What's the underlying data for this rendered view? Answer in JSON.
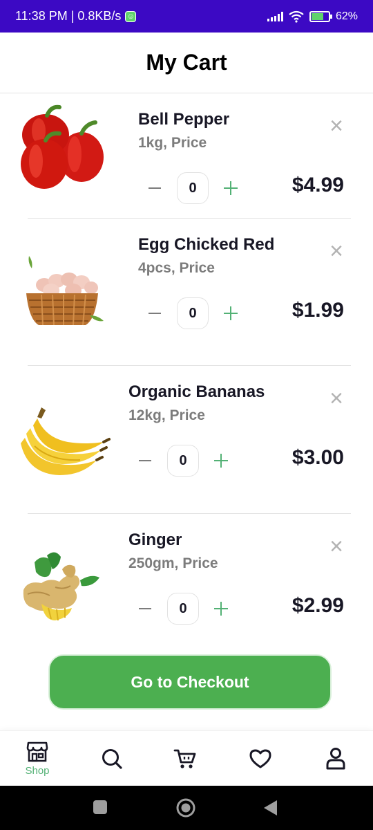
{
  "status_bar": {
    "time": "11:38 PM | 0.8KB/s",
    "battery": "62%",
    "colors": {
      "background": "#3c09c4"
    }
  },
  "header": {
    "title": "My Cart"
  },
  "cart": {
    "items": [
      {
        "name": "Bell Pepper",
        "subtitle": "1kg, Price",
        "quantity": "0",
        "price": "$4.99",
        "image": "bell-pepper-image"
      },
      {
        "name": "Egg Chicked Red",
        "subtitle": "4pcs, Price",
        "quantity": "0",
        "price": "$1.99",
        "image": "egg-basket-image"
      },
      {
        "name": "Organic Bananas",
        "subtitle": "12kg, Price",
        "quantity": "0",
        "price": "$3.00",
        "image": "bananas-image"
      },
      {
        "name": "Ginger",
        "subtitle": "250gm, Price",
        "quantity": "0",
        "price": "$2.99",
        "image": "ginger-image"
      }
    ]
  },
  "checkout": {
    "label": "Go to Checkout",
    "color": "#4caf50"
  },
  "bottom_nav": {
    "active": "shop",
    "items": [
      {
        "id": "shop",
        "label": "Shop",
        "icon": "store-icon"
      },
      {
        "id": "explore",
        "label": "",
        "icon": "search-icon"
      },
      {
        "id": "cart",
        "label": "",
        "icon": "cart-icon"
      },
      {
        "id": "favourite",
        "label": "",
        "icon": "heart-icon"
      },
      {
        "id": "account",
        "label": "",
        "icon": "user-icon"
      }
    ],
    "accent_color": "#53b175"
  },
  "system_nav": {
    "icons": [
      "recents-icon",
      "home-icon",
      "back-icon"
    ]
  }
}
